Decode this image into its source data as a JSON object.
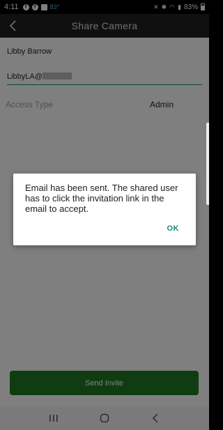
{
  "status_bar": {
    "time": "4:11",
    "temperature": "83°",
    "battery_percent": "83%",
    "battery_level": 0.83
  },
  "header": {
    "title": "Share Camera"
  },
  "form": {
    "owner_name": "Libby Barrow",
    "email_value": "LibbyLA@",
    "access_type_label": "Access Type",
    "access_type_value": "Admin",
    "send_invite_label": "Send Invite"
  },
  "dialog": {
    "message": "Email has been sent. The shared user has to click the invitation link in the email to accept.",
    "ok_label": "OK"
  },
  "colors": {
    "accent": "#1a8a7a",
    "button_green": "#1f7a22",
    "app_bar": "#212121"
  }
}
